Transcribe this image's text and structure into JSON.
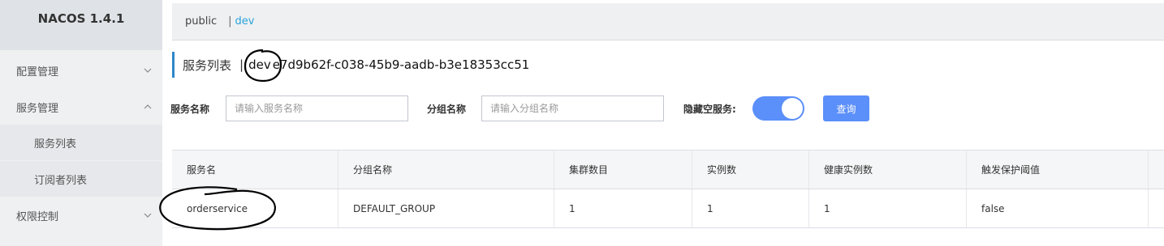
{
  "app": {
    "title": "NACOS 1.4.1"
  },
  "sidebar": {
    "items": [
      {
        "label": "配置管理",
        "chevron": "chevron-down-icon"
      },
      {
        "label": "服务管理",
        "chevron": "chevron-up-icon"
      },
      {
        "label": "服务列表"
      },
      {
        "label": "订阅者列表"
      },
      {
        "label": "权限控制",
        "chevron": "chevron-down-icon"
      }
    ]
  },
  "namespaces": {
    "items": [
      "public",
      "dev"
    ],
    "separator": "|",
    "active": "dev"
  },
  "page": {
    "title": "服务列表",
    "separator": "|",
    "namespace_name": "dev",
    "namespace_id": "e7d9b62f-c038-45b9-aadb-b3e18353cc51"
  },
  "filters": {
    "service_name_label": "服务名称",
    "service_name_placeholder": "请输入服务名称",
    "group_name_label": "分组名称",
    "group_name_placeholder": "请输入分组名称",
    "hide_empty_label": "隐藏空服务:",
    "hide_empty_on": true,
    "query_label": "查询"
  },
  "table": {
    "headers": [
      "服务名",
      "分组名称",
      "集群数目",
      "实例数",
      "健康实例数",
      "触发保护阈值"
    ],
    "rows": [
      [
        "orderservice",
        "DEFAULT_GROUP",
        "1",
        "1",
        "1",
        "false"
      ]
    ]
  },
  "colors": {
    "accent": "#5b8ff9",
    "link": "#2aa4db",
    "title_bar": "#2d87c8"
  }
}
